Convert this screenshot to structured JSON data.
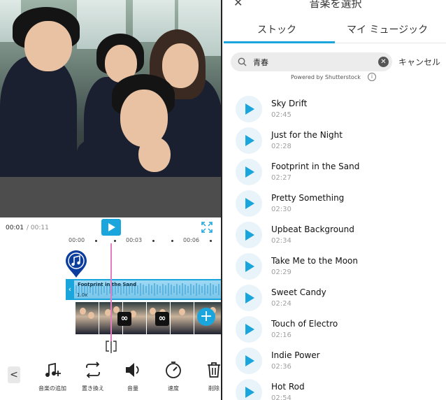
{
  "editor": {
    "time_current": "00:01",
    "time_total": " / 00:11",
    "ruler": [
      "00:00",
      "00:03",
      "00:06"
    ],
    "audio_track": {
      "title": "Footprint in the Sand",
      "speed": "1.0x"
    },
    "transition_icon": "∞",
    "add_clip_label": "+",
    "toolbar": {
      "back_label": "<",
      "items": [
        {
          "label": "音楽の追加",
          "icon": "music-add-icon"
        },
        {
          "label": "置き換え",
          "icon": "replace-icon"
        },
        {
          "label": "音量",
          "icon": "volume-icon"
        },
        {
          "label": "速度",
          "icon": "speed-icon"
        },
        {
          "label": "削除",
          "icon": "trash-icon"
        }
      ]
    }
  },
  "music_picker": {
    "title": "音楽を選択",
    "close_label": "✕",
    "tabs": [
      {
        "label": "ストック",
        "active": true
      },
      {
        "label": "マイ ミュージック",
        "active": false
      }
    ],
    "search": {
      "value": "青春",
      "placeholder": "",
      "clear_label": "✕",
      "cancel_label": "キャンセル"
    },
    "powered_by": "Powered by Shutterstock",
    "info_label": "i",
    "tracks": [
      {
        "title": "Sky Drift",
        "duration": "02:45"
      },
      {
        "title": "Just for the Night",
        "duration": "02:28"
      },
      {
        "title": "Footprint in the Sand",
        "duration": "02:27"
      },
      {
        "title": "Pretty Something",
        "duration": "02:30"
      },
      {
        "title": "Upbeat Background",
        "duration": "02:34"
      },
      {
        "title": "Take Me to the Moon",
        "duration": "02:29"
      },
      {
        "title": "Sweet Candy",
        "duration": "02:24"
      },
      {
        "title": "Touch of Electro",
        "duration": "02:16"
      },
      {
        "title": "Indie Power",
        "duration": "02:36"
      },
      {
        "title": "Hot Rod",
        "duration": "02:54"
      }
    ]
  },
  "colors": {
    "accent": "#1aa5dc",
    "playhead": "#e47dc0",
    "audio_track": "#79c6ea"
  }
}
